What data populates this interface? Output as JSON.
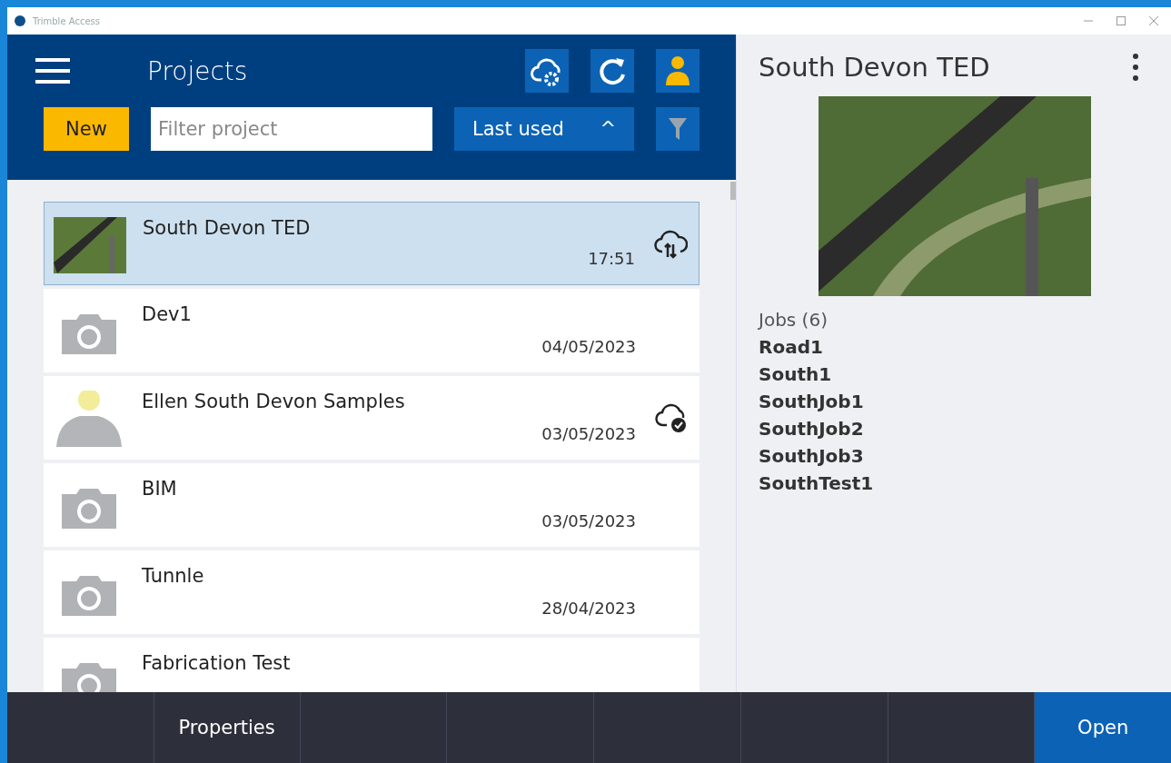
{
  "window": {
    "title": "Trimble Access"
  },
  "header": {
    "title": "Projects",
    "new_button": "New",
    "filter": {
      "placeholder": "Filter project"
    },
    "sort": {
      "label": "Last used",
      "caret": "^"
    }
  },
  "projects": [
    {
      "name": "South Devon TED",
      "date": "17:51",
      "thumbnail": {
        "kind": "photo"
      },
      "sync_icon": {
        "kind": "transfer"
      },
      "selected": true
    },
    {
      "name": "Dev1",
      "date": "04/05/2023",
      "thumbnail": {
        "kind": "camera"
      },
      "selected": false
    },
    {
      "name": "Ellen South Devon Samples",
      "date": "03/05/2023",
      "thumbnail": {
        "kind": "person"
      },
      "sync_icon": {
        "kind": "synced"
      },
      "selected": false
    },
    {
      "name": "BIM",
      "date": "03/05/2023",
      "thumbnail": {
        "kind": "camera"
      },
      "selected": false
    },
    {
      "name": "Tunnle",
      "date": "28/04/2023",
      "thumbnail": {
        "kind": "camera"
      },
      "selected": false
    },
    {
      "name": "Fabrication Test",
      "thumbnail": {
        "kind": "camera"
      },
      "selected": false
    }
  ],
  "details": {
    "title": "South Devon TED",
    "jobs_heading": "Jobs (6)",
    "jobs": [
      "Road1",
      "South1",
      "SouthJob1",
      "SouthJob2",
      "SouthJob3",
      "SouthTest1"
    ]
  },
  "footer": {
    "properties": "Properties",
    "open": "Open"
  }
}
